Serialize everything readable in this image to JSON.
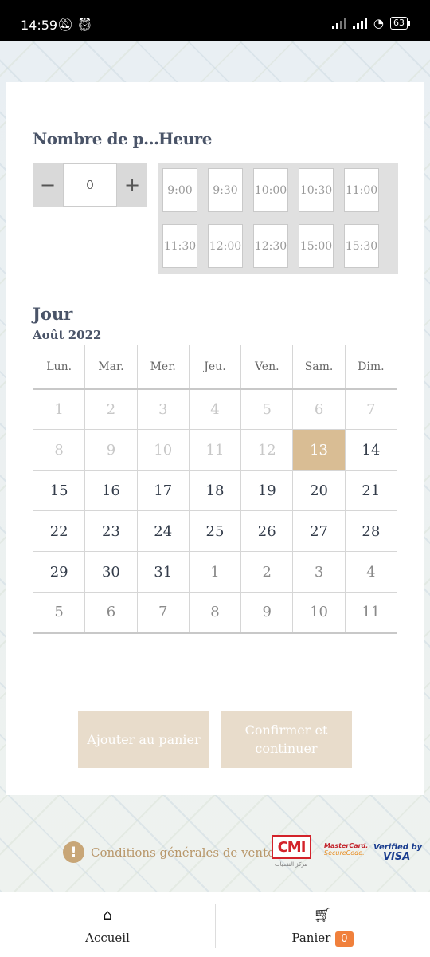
{
  "status_bar": {
    "time": "14:59",
    "battery": "63",
    "icons": [
      "silent-alarm-icon",
      "alarm-clock-icon",
      "signal-icon",
      "signal-icon",
      "wifi-icon",
      "battery-icon"
    ]
  },
  "booking": {
    "guests_label": "Nombre de p...",
    "guests_value": "0",
    "minus": "−",
    "plus": "+",
    "time_label": "Heure",
    "time_slots": [
      "9:00",
      "9:30",
      "10:00",
      "10:30",
      "11:00",
      "11:30",
      "12:00",
      "12:30",
      "15:00",
      "15:30"
    ],
    "day_label": "Jour",
    "month_label": "Août 2022",
    "weekdays": [
      "Lun.",
      "Mar.",
      "Mer.",
      "Jeu.",
      "Ven.",
      "Sam.",
      "Dim."
    ],
    "weeks": [
      [
        {
          "d": "1",
          "s": "off"
        },
        {
          "d": "2",
          "s": "off"
        },
        {
          "d": "3",
          "s": "off"
        },
        {
          "d": "4",
          "s": "off"
        },
        {
          "d": "5",
          "s": "off"
        },
        {
          "d": "6",
          "s": "off"
        },
        {
          "d": "7",
          "s": "off"
        }
      ],
      [
        {
          "d": "8",
          "s": "off"
        },
        {
          "d": "9",
          "s": "off"
        },
        {
          "d": "10",
          "s": "off"
        },
        {
          "d": "11",
          "s": "off"
        },
        {
          "d": "12",
          "s": "off"
        },
        {
          "d": "13",
          "s": "sel"
        },
        {
          "d": "14",
          "s": "on"
        }
      ],
      [
        {
          "d": "15",
          "s": "on"
        },
        {
          "d": "16",
          "s": "on"
        },
        {
          "d": "17",
          "s": "on"
        },
        {
          "d": "18",
          "s": "on"
        },
        {
          "d": "19",
          "s": "on"
        },
        {
          "d": "20",
          "s": "on"
        },
        {
          "d": "21",
          "s": "on"
        }
      ],
      [
        {
          "d": "22",
          "s": "on"
        },
        {
          "d": "23",
          "s": "on"
        },
        {
          "d": "24",
          "s": "on"
        },
        {
          "d": "25",
          "s": "on"
        },
        {
          "d": "26",
          "s": "on"
        },
        {
          "d": "27",
          "s": "on"
        },
        {
          "d": "28",
          "s": "on"
        }
      ],
      [
        {
          "d": "29",
          "s": "on"
        },
        {
          "d": "30",
          "s": "on"
        },
        {
          "d": "31",
          "s": "on"
        },
        {
          "d": "1",
          "s": "next"
        },
        {
          "d": "2",
          "s": "next"
        },
        {
          "d": "3",
          "s": "next"
        },
        {
          "d": "4",
          "s": "next"
        }
      ],
      [
        {
          "d": "5",
          "s": "next"
        },
        {
          "d": "6",
          "s": "next"
        },
        {
          "d": "7",
          "s": "next"
        },
        {
          "d": "8",
          "s": "next"
        },
        {
          "d": "9",
          "s": "next"
        },
        {
          "d": "10",
          "s": "next"
        },
        {
          "d": "11",
          "s": "next"
        }
      ]
    ],
    "selected_color": "#d9bd94",
    "add_to_cart": "Ajouter au panier",
    "confirm": "Confirmer et continuer"
  },
  "footer": {
    "cgv": "Conditions générales de vente",
    "cgv_icon": "!",
    "cmi": "CMI",
    "cmi_sub": "مركز النقديات",
    "mastercard": "MasterCard.",
    "securecode": "SecureCode.",
    "verified_by": "Verified by",
    "visa": "VISA"
  },
  "nav": {
    "home_label": "Accueil",
    "home_icon": "home-icon",
    "cart_label": "Panier",
    "cart_icon": "cart-icon",
    "cart_count": "0"
  }
}
